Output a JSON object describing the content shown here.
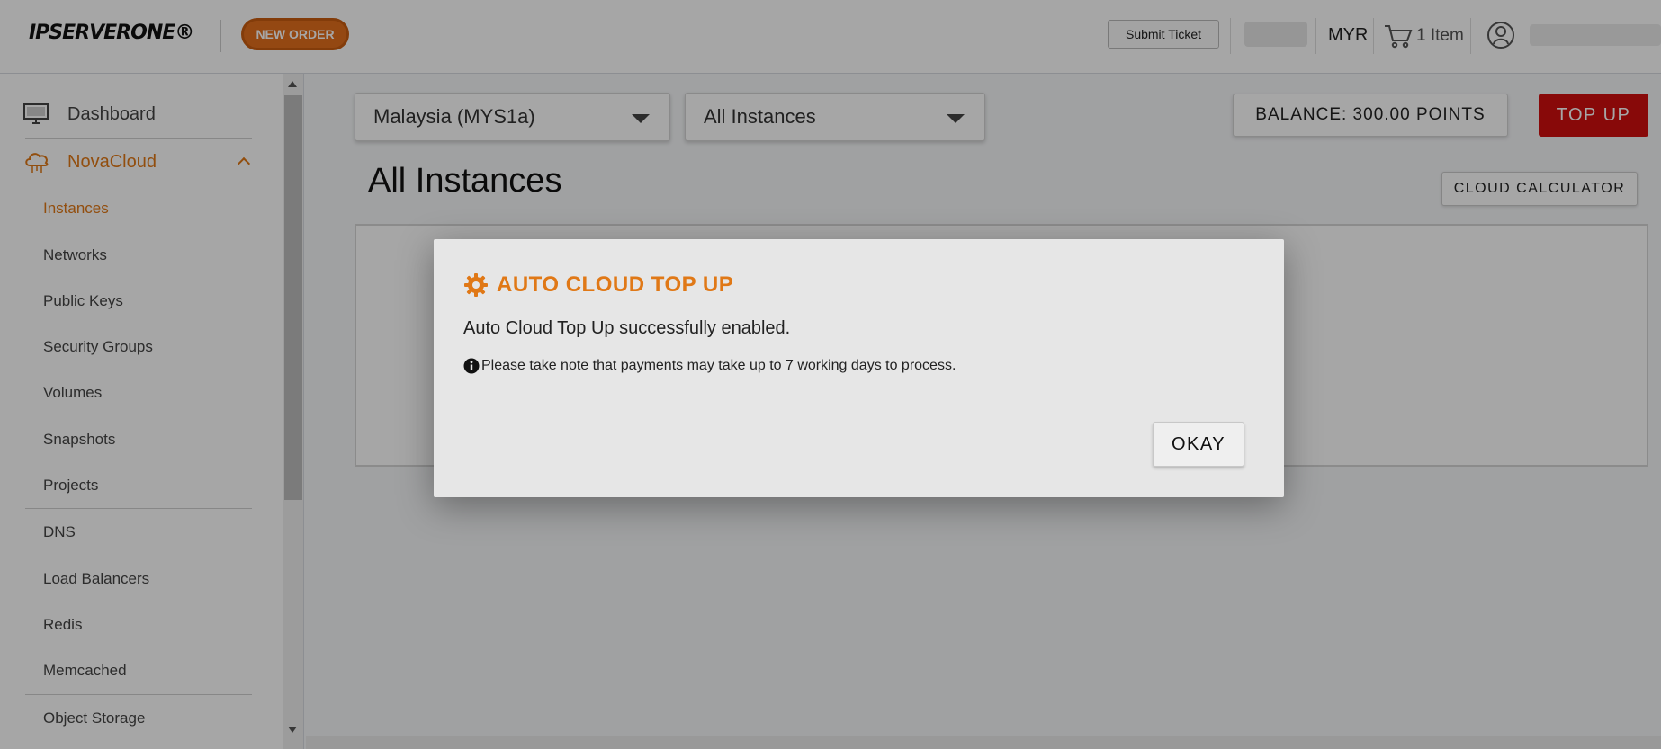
{
  "header": {
    "logo_text": "IPSERVERONE®",
    "new_order_label": "NEW ORDER",
    "submit_ticket_label": "Submit Ticket",
    "currency": "MYR",
    "cart_label": "1 Item"
  },
  "sidebar": {
    "items": [
      {
        "label": "Dashboard",
        "icon": "monitor-icon"
      },
      {
        "label": "NovaCloud",
        "icon": "cloud-icon",
        "active": true
      },
      {
        "label": "Instances",
        "active": true
      },
      {
        "label": "Networks"
      },
      {
        "label": "Public Keys"
      },
      {
        "label": "Security Groups"
      },
      {
        "label": "Volumes"
      },
      {
        "label": "Snapshots"
      },
      {
        "label": "Projects"
      },
      {
        "label": "DNS"
      },
      {
        "label": "Load Balancers"
      },
      {
        "label": "Redis"
      },
      {
        "label": "Memcached"
      },
      {
        "label": "Object Storage"
      }
    ]
  },
  "main": {
    "region_select": "Malaysia (MYS1a)",
    "instance_filter": "All Instances",
    "balance_label": "BALANCE: 300.00 POINTS",
    "topup_label": "TOP UP",
    "page_title": "All Instances",
    "calculator_label": "CLOUD CALCULATOR"
  },
  "modal": {
    "title": "AUTO CLOUD TOP UP",
    "message": "Auto Cloud Top Up successfully enabled.",
    "note": "Please take note that payments may take up to 7 working days to process.",
    "okay_label": "OKAY"
  },
  "colors": {
    "accent": "#e07816",
    "topup": "#d20f0f"
  }
}
